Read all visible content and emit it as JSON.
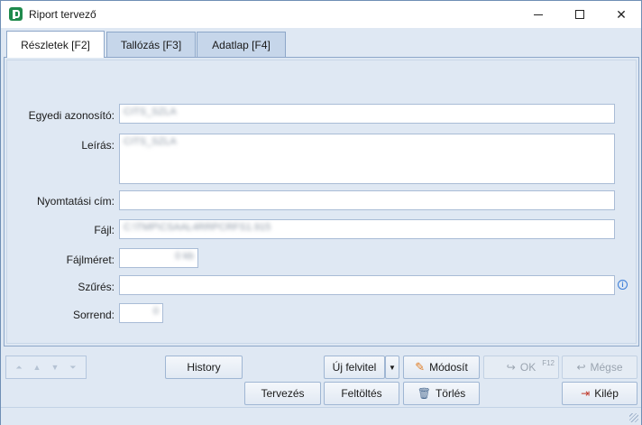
{
  "window": {
    "title": "Riport tervező"
  },
  "tabs": [
    {
      "label": "Részletek [F2]",
      "active": true
    },
    {
      "label": "Tallózás [F3]",
      "active": false
    },
    {
      "label": "Adatlap [F4]",
      "active": false
    }
  ],
  "form": {
    "id_label": "Egyedi azonosító:",
    "id_value": "CITS_SZLA",
    "desc_label": "Leírás:",
    "desc_value": "CITS_SZLA",
    "print_title_label": "Nyomtatási cím:",
    "print_title_value": "",
    "file_label": "Fájl:",
    "file_value": "C:\\TMP\\CSAAL4RRPCRFS1.915",
    "filesize_label": "Fájlméret:",
    "filesize_value": "0 kb",
    "filter_label": "Szűrés:",
    "filter_value": "",
    "order_label": "Sorrend:",
    "order_value": "0"
  },
  "buttons": {
    "history": "History",
    "new_record": "Új felvitel",
    "modify": "Módosít",
    "ok": "OK",
    "ok_shortcut": "F12",
    "cancel": "Mégse",
    "design": "Tervezés",
    "upload": "Feltöltés",
    "delete": "Törlés",
    "exit": "Kilép"
  },
  "colors": {
    "accent": "#1f8a4c",
    "panel": "#dfe8f3",
    "border": "#8da7c9"
  }
}
